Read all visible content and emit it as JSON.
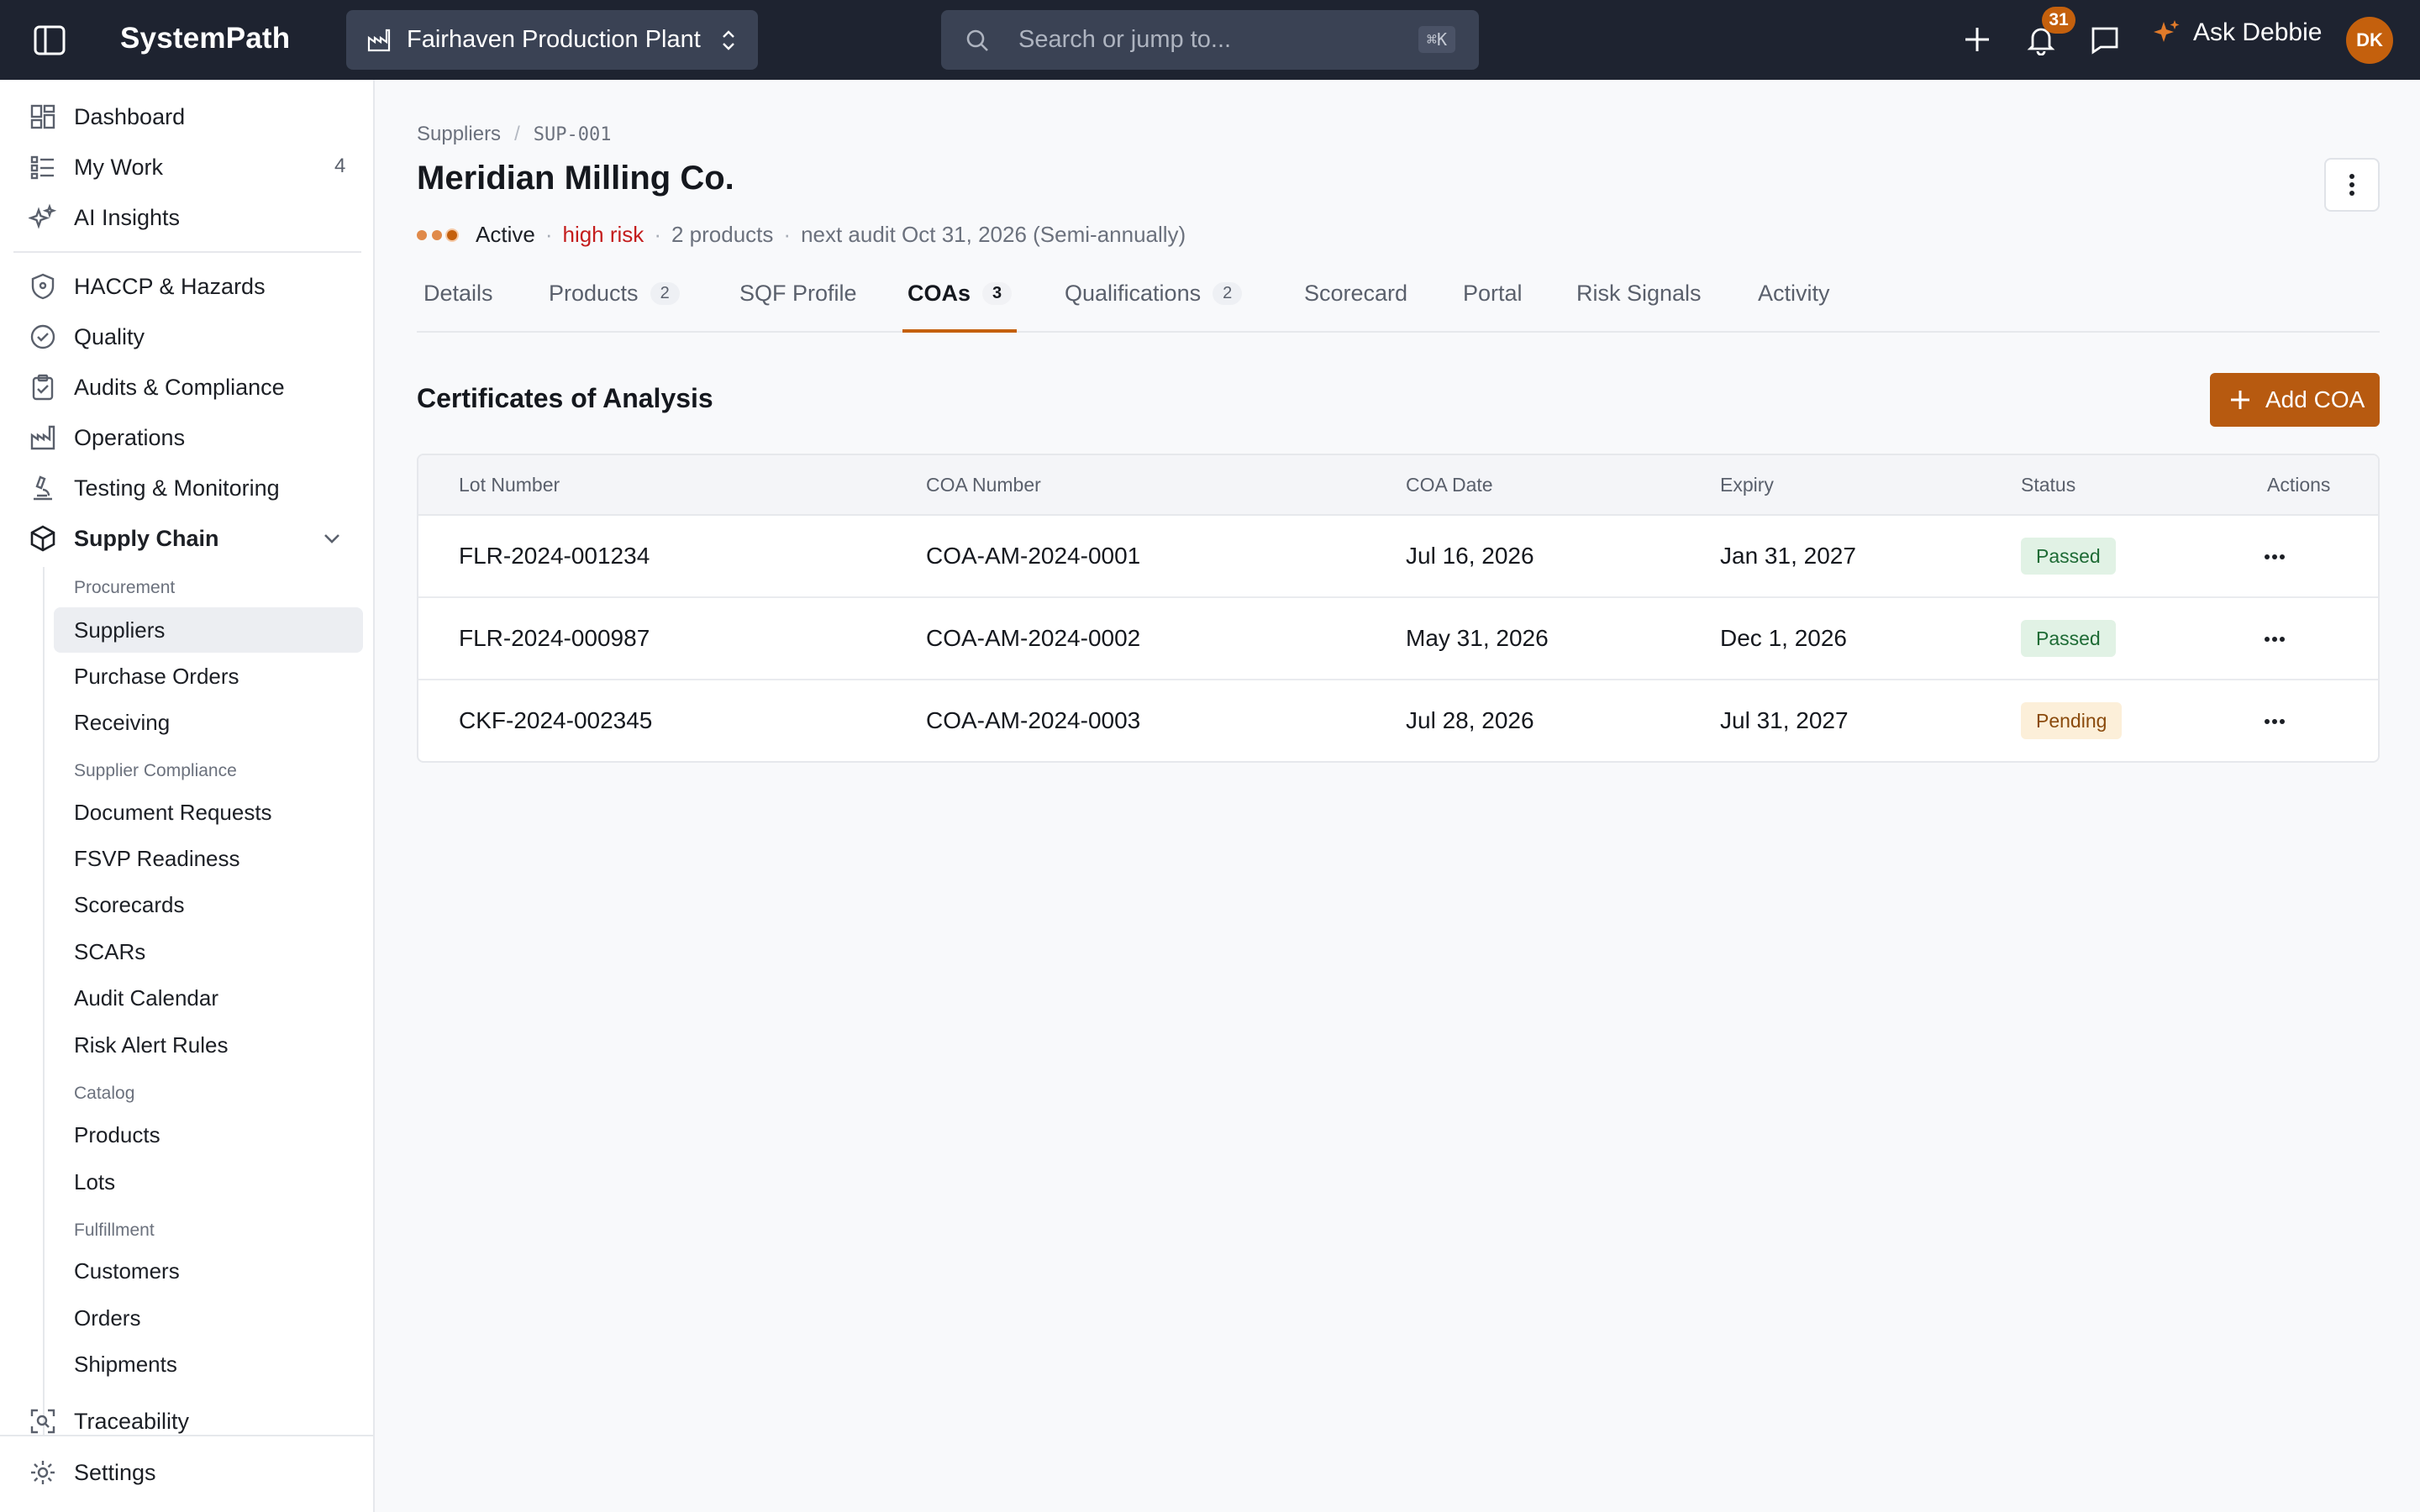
{
  "topbar": {
    "brand": "SystemPath",
    "plant": "Fairhaven Production Plant",
    "search_placeholder": "Search or jump to...",
    "search_shortcut": "⌘K",
    "notification_count": "31",
    "ask_label": "Ask Debbie",
    "avatar_initials": "DK"
  },
  "sidebar": {
    "top_items": [
      {
        "label": "Dashboard",
        "icon": "dashboard-grid-icon"
      },
      {
        "label": "My Work",
        "icon": "list-icon",
        "count": "4"
      },
      {
        "label": "AI Insights",
        "icon": "sparkles-icon"
      }
    ],
    "modules": [
      {
        "label": "HACCP & Hazards",
        "icon": "shield-icon"
      },
      {
        "label": "Quality",
        "icon": "check-circle-icon"
      },
      {
        "label": "Audits & Compliance",
        "icon": "clipboard-check-icon"
      },
      {
        "label": "Operations",
        "icon": "factory-icon"
      },
      {
        "label": "Testing & Monitoring",
        "icon": "microscope-icon"
      },
      {
        "label": "Supply Chain",
        "icon": "package-icon"
      }
    ],
    "groups": {
      "procurement": "Procurement",
      "supplier_compliance": "Supplier Compliance",
      "catalog": "Catalog",
      "fulfillment": "Fulfillment"
    },
    "sub_items": {
      "suppliers": "Suppliers",
      "purchase_orders": "Purchase Orders",
      "receiving": "Receiving",
      "document_requests": "Document Requests",
      "fsvp_readiness": "FSVP Readiness",
      "scorecards": "Scorecards",
      "scars": "SCARs",
      "audit_calendar": "Audit Calendar",
      "risk_alert_rules": "Risk Alert Rules",
      "products": "Products",
      "lots": "Lots",
      "customers": "Customers",
      "orders": "Orders",
      "shipments": "Shipments"
    },
    "traceability": "Traceability",
    "settings": "Settings"
  },
  "main": {
    "breadcrumb": {
      "parent": "Suppliers",
      "current": "SUP-001"
    },
    "title": "Meridian Milling Co.",
    "meta": {
      "status": "Active",
      "risk": "high risk",
      "products": "2 products",
      "next_audit": "next audit Oct 31, 2026 (Semi-annually)"
    },
    "tabs": [
      {
        "label": "Details"
      },
      {
        "label": "Products",
        "badge": "2"
      },
      {
        "label": "SQF Profile"
      },
      {
        "label": "COAs",
        "badge": "3"
      },
      {
        "label": "Qualifications",
        "badge": "2"
      },
      {
        "label": "Scorecard"
      },
      {
        "label": "Portal"
      },
      {
        "label": "Risk Signals"
      },
      {
        "label": "Activity"
      }
    ],
    "section_title": "Certificates of Analysis",
    "add_button": "Add COA",
    "table": {
      "headers": [
        "Lot Number",
        "COA Number",
        "COA Date",
        "Expiry",
        "Status",
        "Actions"
      ],
      "rows": [
        {
          "lot": "FLR-2024-001234",
          "coa": "COA-AM-2024-0001",
          "date": "Jul 16, 2026",
          "expiry": "Jan 31, 2027",
          "status": "Passed"
        },
        {
          "lot": "FLR-2024-000987",
          "coa": "COA-AM-2024-0002",
          "date": "May 31, 2026",
          "expiry": "Dec 1, 2026",
          "status": "Passed"
        },
        {
          "lot": "CKF-2024-002345",
          "coa": "COA-AM-2024-0003",
          "date": "Jul 28, 2026",
          "expiry": "Jul 31, 2027",
          "status": "Pending"
        }
      ]
    }
  },
  "colors": {
    "topbar": "#1e2330",
    "accent": "#c4600d",
    "risk_high": "#c41d1d",
    "passed_bg": "#e1f2e5",
    "pending_bg": "#fcefd9"
  }
}
